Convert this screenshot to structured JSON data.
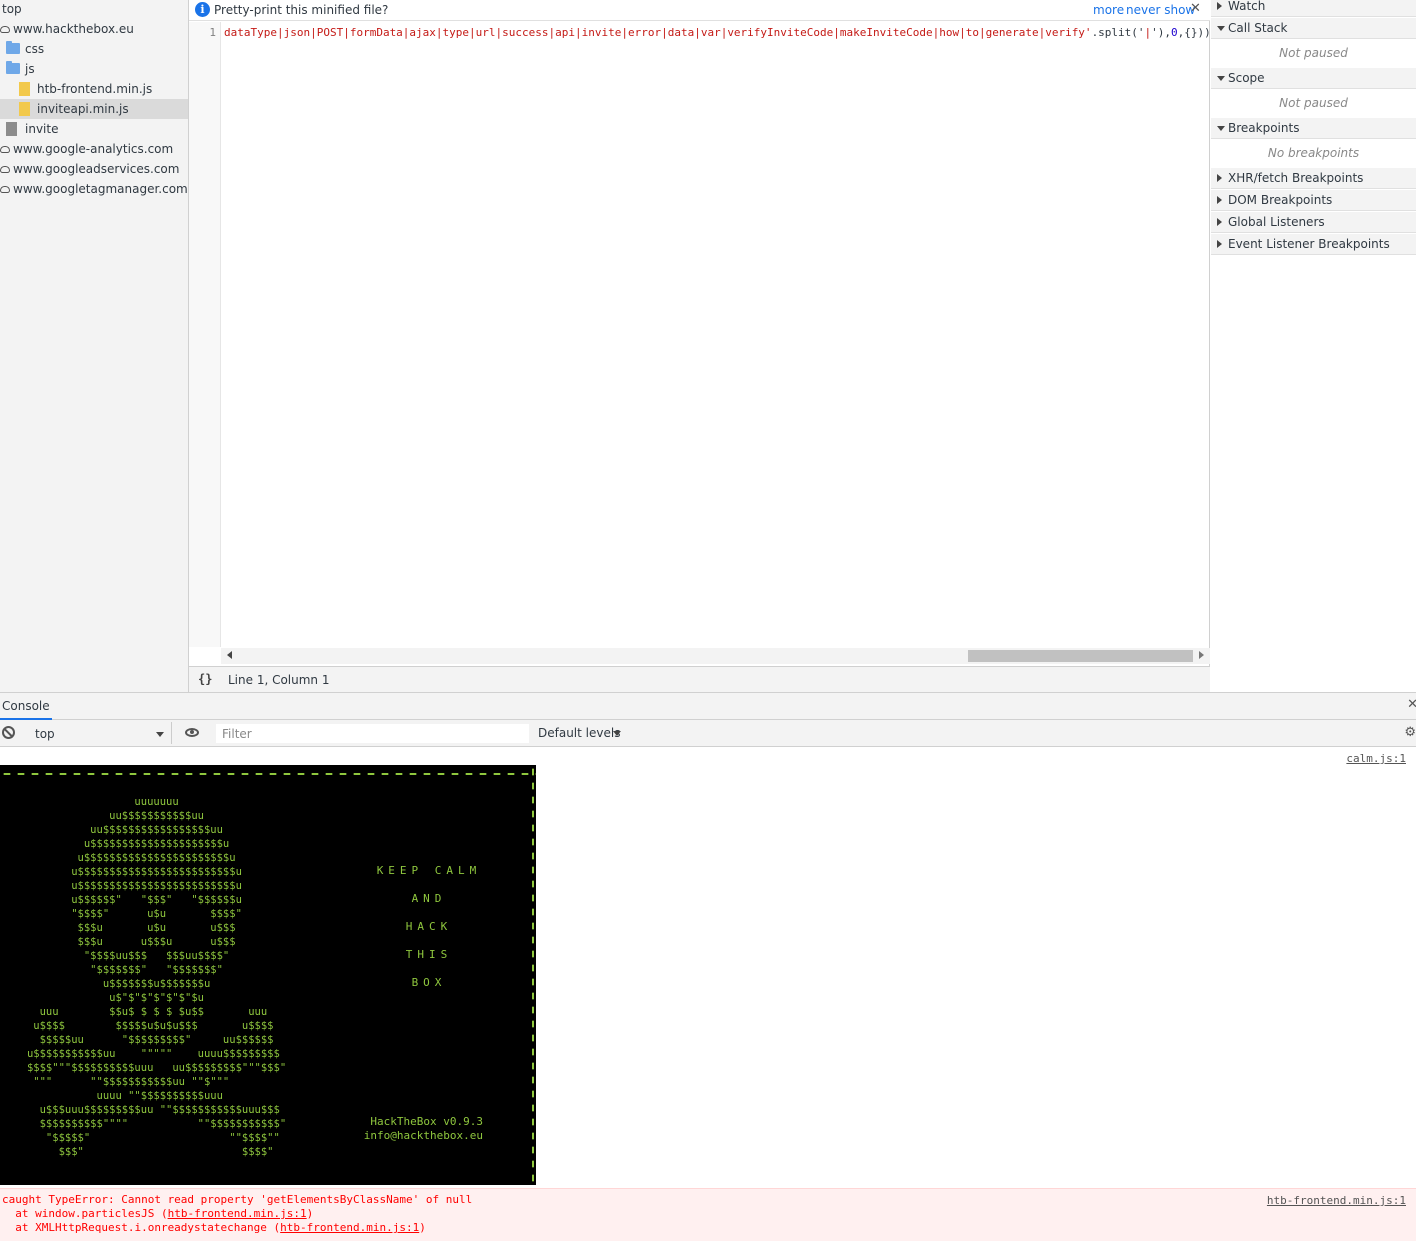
{
  "navigator": {
    "items": [
      {
        "label": "top"
      },
      {
        "label": "www.hackthebox.eu"
      },
      {
        "label": "css"
      },
      {
        "label": "js"
      },
      {
        "label": "htb-frontend.min.js"
      },
      {
        "label": "inviteapi.min.js"
      },
      {
        "label": "invite"
      },
      {
        "label": "www.google-analytics.com"
      },
      {
        "label": "www.googleadservices.com"
      },
      {
        "label": "www.googletagmanager.com"
      }
    ]
  },
  "editor": {
    "infobar": {
      "text": "Pretty-print this minified file?",
      "more": "more",
      "never_show": "never show",
      "close": "✕"
    },
    "line_number": "1",
    "code": {
      "string": "dataType|json|POST|formData|ajax|type|url|success|api|invite|error|data|var|verifyInviteCode|makeInviteCode|how|to|generate|verify'",
      "mid1": ".split('",
      "sep": "|",
      "mid2": "'),",
      "zero": "0",
      "tail": ",{}))"
    },
    "status": {
      "pretty_print": "{}",
      "cursor": "Line 1, Column 1"
    }
  },
  "sidebar": {
    "watch": "Watch",
    "call_stack": "Call Stack",
    "call_stack_msg": "Not paused",
    "scope": "Scope",
    "scope_msg": "Not paused",
    "breakpoints": "Breakpoints",
    "breakpoints_msg": "No breakpoints",
    "xhr": "XHR/fetch Breakpoints",
    "dom": "DOM Breakpoints",
    "global": "Global Listeners",
    "event": "Event Listener Breakpoints"
  },
  "console": {
    "tab": "Console",
    "context": "top",
    "filter_placeholder": "Filter",
    "levels": "Default levels",
    "source_1": "calm.js:1",
    "skull": "                    uuuuuuu\n                uu$$$$$$$$$$$uu\n             uu$$$$$$$$$$$$$$$$$uu\n            u$$$$$$$$$$$$$$$$$$$$$u\n           u$$$$$$$$$$$$$$$$$$$$$$$u\n          u$$$$$$$$$$$$$$$$$$$$$$$$$u\n          u$$$$$$$$$$$$$$$$$$$$$$$$$u\n          u$$$$$$\"   \"$$$\"   \"$$$$$$u\n          \"$$$$\"      u$u       $$$$\"\n           $$$u       u$u       u$$$\n           $$$u      u$$$u      u$$$\n            \"$$$$uu$$$   $$$uu$$$$\"\n             \"$$$$$$$\"   \"$$$$$$$\"\n               u$$$$$$$u$$$$$$$u\n                u$\"$\"$\"$\"$\"$\"$u\n     uuu        $$u$ $ $ $ $u$$       uuu\n    u$$$$        $$$$$u$u$u$$$       u$$$$\n     $$$$$uu      \"$$$$$$$$$\"     uu$$$$$$\n   u$$$$$$$$$$$uu    \"\"\"\"\"    uuuu$$$$$$$$$\n   $$$$\"\"\"$$$$$$$$$$uuu   uu$$$$$$$$$\"\"\"$$$\"\n    \"\"\"      \"\"$$$$$$$$$$$uu \"\"$\"\"\"\n              uuuu \"\"$$$$$$$$$$uuu\n     u$$$uuu$$$$$$$$$uu \"\"$$$$$$$$$$$uuu$$$\n     $$$$$$$$$$\"\"\"\"           \"\"$$$$$$$$$$$\"\n      \"$$$$$\"                      \"\"$$$$\"\"\n        $$$\"                         $$$$\"",
    "keep_lines": [
      "KEEP CALM",
      "AND",
      "HACK",
      "THIS",
      "BOX"
    ],
    "htb_version": "HackTheBox v0.9.3",
    "htb_email": "info@hackthebox.eu",
    "error": {
      "line1": "caught TypeError: Cannot read property 'getElementsByClassName' of null",
      "line2_prefix": "  at window.particlesJS (",
      "line2_link": "htb-frontend.min.js:1",
      "line2_suffix": ")",
      "line3_prefix": "  at XMLHttpRequest.i.onreadystatechange (",
      "line3_link": "htb-frontend.min.js:1",
      "line3_suffix": ")",
      "source": "htb-frontend.min.js:1"
    }
  },
  "colors": {
    "accent": "#1a73e8",
    "ascii_green": "#8fc73e",
    "error_red": "#ff0000",
    "string_red": "#c41a16"
  }
}
